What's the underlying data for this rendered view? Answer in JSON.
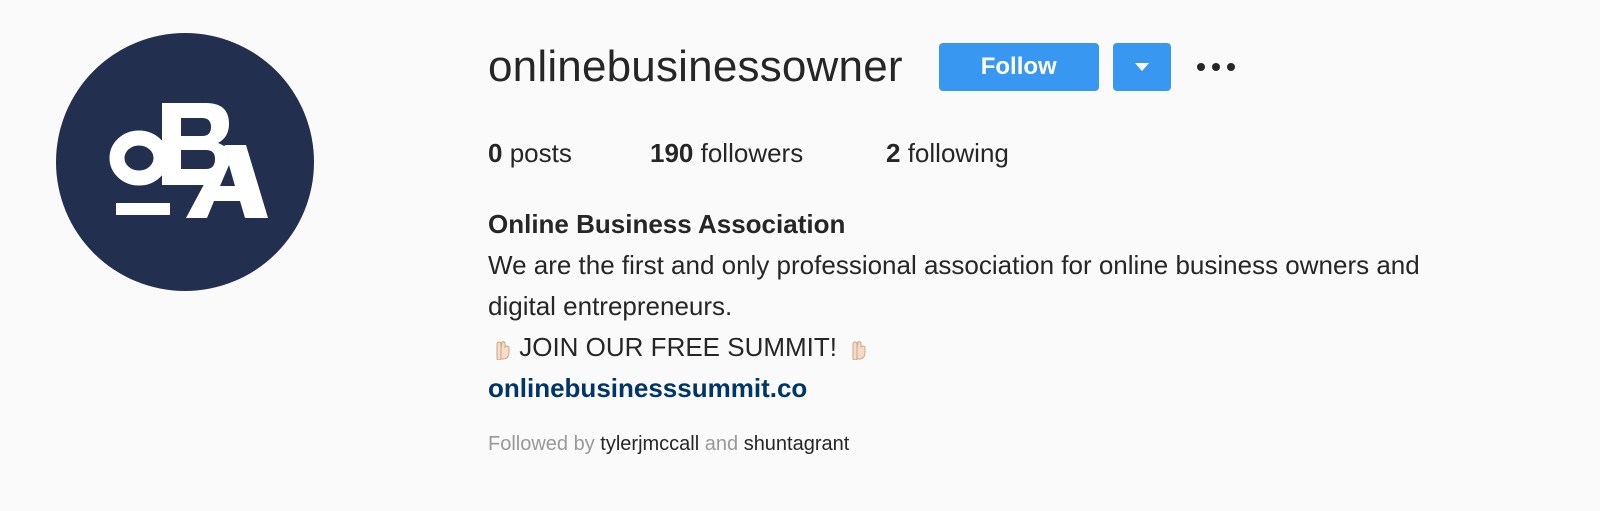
{
  "profile": {
    "avatar_text": "OBA",
    "username": "onlinebusinessowner",
    "follow_label": "Follow",
    "dropdown_icon": "caret-down-icon",
    "more_icon": "ellipsis-icon"
  },
  "stats": {
    "posts_count": "0",
    "posts_label": "posts",
    "followers_count": "190",
    "followers_label": "followers",
    "following_count": "2",
    "following_label": "following"
  },
  "bio": {
    "full_name": "Online Business Association",
    "line1": "We are the first and only professional association for online business owners and",
    "line2": "digital entrepreneurs.",
    "cta_text": "JOIN OUR FREE SUMMIT!",
    "cta_icon": "pointing-down-hand-icon",
    "website": "onlinebusinesssummit.co"
  },
  "followed_by": {
    "prefix": "Followed by",
    "user1": "tylerjmccall",
    "joiner": "and",
    "user2": "shuntagrant"
  },
  "colors": {
    "accent": "#3897f0",
    "avatar_bg": "#222f4f",
    "link": "#003569",
    "background": "#fafafa"
  }
}
